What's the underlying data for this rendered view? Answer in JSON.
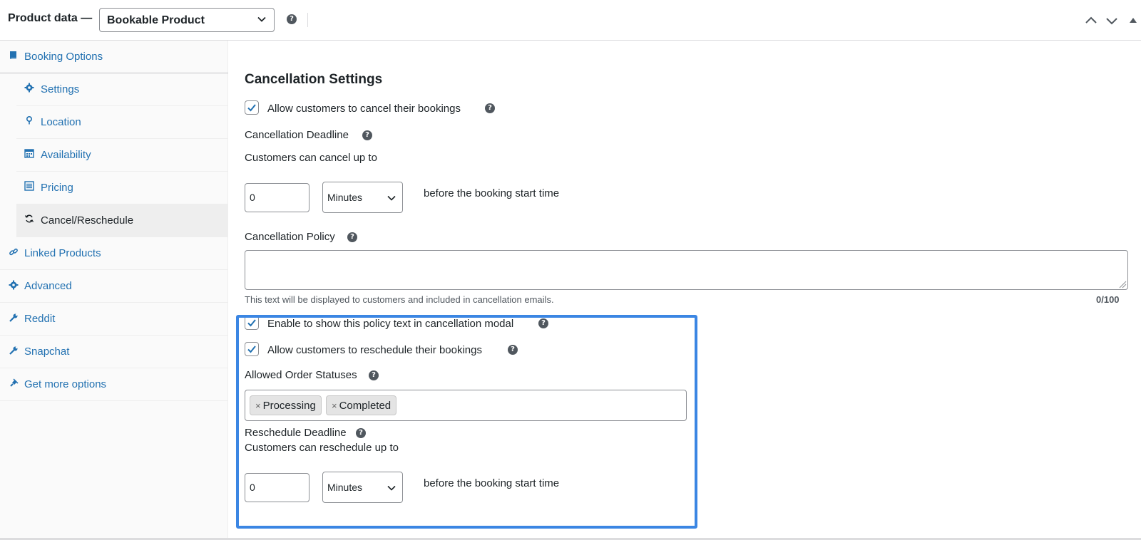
{
  "header": {
    "title": "Product data —",
    "product_type": "Bookable Product",
    "help_glyph": "?"
  },
  "sidebar": {
    "booking_options": "Booking Options",
    "sub_items": [
      {
        "label": "Settings",
        "icon": "gear-icon"
      },
      {
        "label": "Location",
        "icon": "location-pin-icon"
      },
      {
        "label": "Availability",
        "icon": "calendar-icon"
      },
      {
        "label": "Pricing",
        "icon": "list-icon"
      },
      {
        "label": "Cancel/Reschedule",
        "icon": "refresh-icon",
        "active": true
      }
    ],
    "items": [
      {
        "label": "Linked Products",
        "icon": "link-icon"
      },
      {
        "label": "Advanced",
        "icon": "gear-icon"
      },
      {
        "label": "Reddit",
        "icon": "wrench-icon"
      },
      {
        "label": "Snapchat",
        "icon": "wrench-icon"
      },
      {
        "label": "Get more options",
        "icon": "plugin-icon"
      }
    ]
  },
  "main": {
    "section_title": "Cancellation Settings",
    "allow_cancel": {
      "label": "Allow customers to cancel their bookings",
      "checked": true
    },
    "cancel_deadline": {
      "label": "Cancellation Deadline",
      "sub_label": "Customers can cancel up to",
      "value": "0",
      "unit": "Minutes",
      "suffix": "before the booking start time"
    },
    "policy": {
      "label": "Cancellation Policy",
      "value": "",
      "hint": "This text will be displayed to customers and included in cancellation emails.",
      "counter": "0/100"
    },
    "show_policy": {
      "label": "Enable to show this policy text in cancellation modal",
      "checked": true
    },
    "allow_reschedule": {
      "label": "Allow customers to reschedule their bookings",
      "checked": true
    },
    "statuses": {
      "label": "Allowed Order Statuses",
      "remove_glyph": "×",
      "chips": [
        "Processing",
        "Completed"
      ]
    },
    "reschedule_deadline": {
      "label": "Reschedule Deadline",
      "sub_label": "Customers can reschedule up to",
      "value": "0",
      "unit": "Minutes",
      "suffix": "before the booking start time"
    }
  },
  "colors": {
    "link": "#2271b1",
    "highlight": "#3b86e3",
    "text": "#1d2327"
  }
}
